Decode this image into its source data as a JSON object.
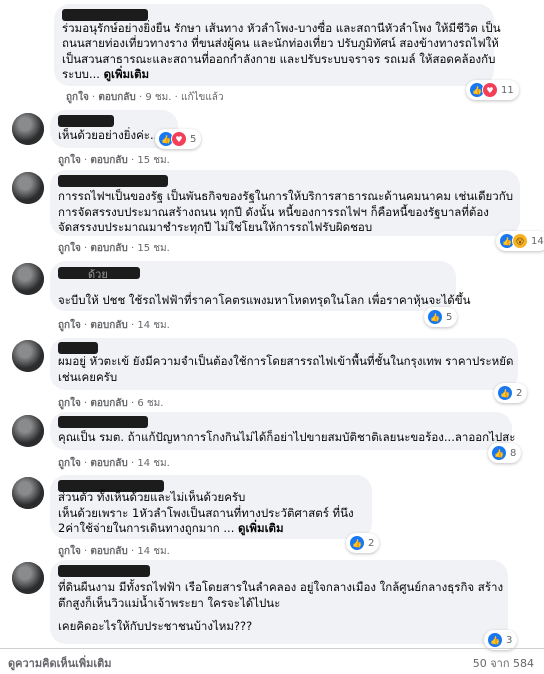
{
  "comments": [
    {
      "lines": [
        "ร่วมอนุรักษ์อย่างยิ่งยืน รักษา เส้นทาง หัวลำโพง-บางซื่อ และสถานีหัวลำโพง ให้มีชีวิต เป็น",
        "ถนนสายท่องเที่ยวทางราง ที่ขนส่งผู้คน และนักท่องเที่ยว ปรับภูมิทัศน์ สองข้างทางรถไฟให้",
        "เป็นสวนสาธารณะและสถานที่ออกกำลังกาย และปรับระบบจราจร รถเมล์ ให้สอดคล้องกับ",
        "ระบบ..."
      ],
      "see_more": "ดูเพิ่มเติม",
      "like": "ถูกใจ",
      "reply": "ตอบกลับ",
      "time": "9 ชม.",
      "edited": "แก้ไขแล้ว",
      "reactions": [
        "like",
        "love"
      ],
      "reaction_count": "11"
    },
    {
      "lines": [
        "เห็นด้วยอย่างยิ่งค่ะ..."
      ],
      "like": "ถูกใจ",
      "reply": "ตอบกลับ",
      "time": "15 ชม.",
      "reactions": [
        "like",
        "love"
      ],
      "reaction_count": "5"
    },
    {
      "lines": [
        "การรถไฟฯเป็นของรัฐ เป็นพันธกิจของรัฐในการให้บริการสาธารณะด้านคมนาคม เช่นเดียวกับ",
        "การจัดสรรงบประมาณสร้างถนน ทุกปี ดังนั้น หนี้ของการรถไฟฯ ก็คือหนี้ของรัฐบาลที่ต้อง",
        "จัดสรรงบประมาณมาชำระทุกปี ไม่ใช่โยนให้การรถไฟรับผิดชอบ"
      ],
      "like": "ถูกใจ",
      "reply": "ตอบกลับ",
      "time": "15 ชม.",
      "reactions": [
        "like",
        "wow"
      ],
      "reaction_count": "14"
    },
    {
      "name_fragment": "ด้วย",
      "lines": [
        "จะบีบให้ ปชช ใช้รถไฟฟ้าที่ราคาโคตรแพงมหาโหดทรุดในโลก เพื่อราคาหุ้นจะได้ขึ้น"
      ],
      "like": "ถูกใจ",
      "reply": "ตอบกลับ",
      "time": "14 ชม.",
      "reactions": [
        "like"
      ],
      "reaction_count": "5"
    },
    {
      "lines": [
        "ผมอยู่ หัวตะเข้ ยังมีความจำเป็นต้องใช้การโดยสารรถไฟเข้าพื้นที่ชั้นในกรุงเทพ ราคาประหยัด",
        "เช่นเคยครับ"
      ],
      "like": "ถูกใจ",
      "reply": "ตอบกลับ",
      "time": "6 ชม.",
      "reactions": [
        "like"
      ],
      "reaction_count": "2"
    },
    {
      "lines": [
        "คุณเป็น รมต. ถ้าแก้ปัญหาการโกงกินไม่ได้ก็อย่าไปขายสมบัติชาติเลยนะขอร้อง...ลาออกไปสะ"
      ],
      "like": "ถูกใจ",
      "reply": "ตอบกลับ",
      "time": "14 ชม.",
      "reactions": [
        "like"
      ],
      "reaction_count": "8"
    },
    {
      "lines": [
        "ส่วนตัว ทั้งเห็นด้วยและไม่เห็นด้วยครับ",
        "เห็นด้วยเพราะ 1หัวลำโพงเป็นสถานที่ทางประวัติศาสตร์ ที่นึง",
        "2ค่าใช้จ่ายในการเดินทางถูกมาก ..."
      ],
      "see_more": "ดูเพิ่มเติม",
      "like": "ถูกใจ",
      "reply": "ตอบกลับ",
      "time": "14 ชม.",
      "reactions": [
        "like"
      ],
      "reaction_count": "2"
    },
    {
      "lines": [
        "ที่ดินผืนงาม มีทั้งรถไฟฟ้า เรือโดยสารในลำคลอง อยู่ใจกลางเมือง ใกล้ศูนย์กลางธุรกิจ สร้าง",
        "ตึกสูงก็เห็นวิวแม่น้ำเจ้าพระยา ใครจะได้ไปนะ",
        "",
        "เคยคิดอะไรให้กับประชาชนบ้างไหม???"
      ],
      "like": "ถูกใจ",
      "reply": "ตอบกลับ",
      "time": "14 ชม.",
      "reactions": [
        "like"
      ],
      "reaction_count": "3"
    }
  ],
  "footer": {
    "more_comments": "ดูความคิดเห็นเพิ่มเติม",
    "count": "50 จาก 584"
  },
  "colors": {
    "bubble": "#f0f2f5",
    "meta": "#65676b",
    "like_blue": "#1877f2",
    "love_red": "#f33e58",
    "wow_yellow": "#f7b125"
  },
  "icons": {
    "like": "thumbs-up-icon",
    "love": "heart-icon",
    "wow": "wow-face-icon"
  }
}
